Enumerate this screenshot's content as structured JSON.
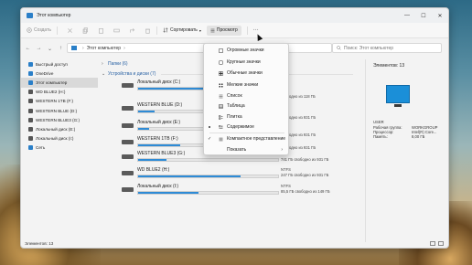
{
  "window": {
    "title": "Этот компьютер",
    "controls": [
      "—",
      "☐",
      "✕"
    ]
  },
  "toolbar": {
    "create_label": "Создать",
    "sort_label": "Сортировать",
    "view_label": "Просмотр",
    "more_label": "···"
  },
  "address": {
    "crumbs": [
      "Этот компьютер"
    ],
    "search_placeholder": "Поиск: Этот компьютер"
  },
  "sidebar": {
    "items": [
      {
        "label": "Быстрый доступ",
        "icon": "star-icon",
        "color": "#2a7fc8"
      },
      {
        "label": "OneDrive",
        "icon": "cloud-icon",
        "color": "#2a7fc8"
      },
      {
        "label": "Этот компьютер",
        "icon": "monitor-icon",
        "color": "#2a7fc8"
      },
      {
        "label": "WD BLUE2 (H:)",
        "icon": "drive-icon",
        "color": "#555555"
      },
      {
        "label": "WESTERN 1TB (F:)",
        "icon": "drive-icon",
        "color": "#555555"
      },
      {
        "label": "WESTERN BLUE (D:)",
        "icon": "drive-icon",
        "color": "#555555"
      },
      {
        "label": "WESTERN BLUE3 (G:)",
        "icon": "drive-icon",
        "color": "#555555"
      },
      {
        "label": "Локальный диск (E:)",
        "icon": "drive-icon",
        "color": "#555555"
      },
      {
        "label": "Локальный диск (I:)",
        "icon": "drive-icon",
        "color": "#555555"
      },
      {
        "label": "Сеть",
        "icon": "network-icon",
        "color": "#2a7fc8"
      }
    ]
  },
  "content": {
    "folders_group": "Папки (6)",
    "drives_group": "Устройства и диски (7)",
    "drives": [
      {
        "name": "Локальный диск (C:)",
        "free": "свободно из 118 ГБ",
        "used_fraction": 0.85
      },
      {
        "name": "WESTERN BLUE (D:)",
        "free": "свободно из 931 ГБ",
        "used_fraction": 0.12
      },
      {
        "name": "Локальный диск (E:)",
        "free": "свободно из 931 ГБ",
        "used_fraction": 0.08
      },
      {
        "name": "WESTERN 1TB (F:)",
        "free": "свободно из 931 ГБ",
        "used_fraction": 0.3
      },
      {
        "name": "WESTERN BLUE3 (G:)",
        "free": "741 ГБ свободно из 931 ГБ",
        "used_fraction": 0.2
      },
      {
        "name": "WD BLUE2 (H:)",
        "free": "247 ГБ свободно из 931 ГБ",
        "used_fraction": 0.73,
        "fs": "NTFS"
      },
      {
        "name": "Локальный диск (I:)",
        "free": "85,5 ГБ свободно из 149 ГБ",
        "used_fraction": 0.43,
        "fs": "NTFS"
      }
    ]
  },
  "details": {
    "count": "Элементов: 13",
    "user_label": "USER",
    "props": [
      {
        "k": "Рабочая группа:",
        "v": "WORKGROUP"
      },
      {
        "k": "Процессор:",
        "v": "Intel(R) Core..."
      },
      {
        "k": "Память:",
        "v": "8,00 ГБ"
      }
    ]
  },
  "view_menu": {
    "items": [
      {
        "label": "Огромные значки",
        "icon": "square-icon"
      },
      {
        "label": "Крупные значки",
        "icon": "square-icon"
      },
      {
        "label": "Обычные значки",
        "icon": "grid-icon"
      },
      {
        "label": "Мелкие значки",
        "icon": "grid-icon"
      },
      {
        "label": "Список",
        "icon": "list-icon"
      },
      {
        "label": "Таблица",
        "icon": "table-icon"
      },
      {
        "label": "Плитка",
        "icon": "tiles-icon"
      },
      {
        "label": "Содержимое",
        "icon": "content-icon"
      },
      {
        "label": "Компактное представление",
        "icon": "compact-icon"
      },
      {
        "label": "Показать",
        "icon": ""
      }
    ]
  },
  "status": {
    "count": "Элементов: 13"
  }
}
